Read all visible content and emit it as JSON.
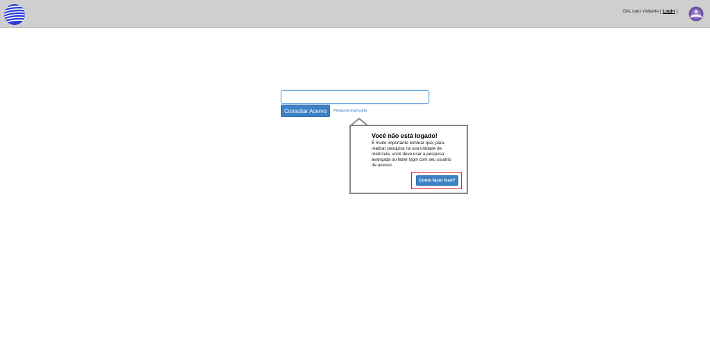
{
  "header": {
    "logo_icon": "globe-logo-icon",
    "greeting_prefix": "Olá, caro visitante [",
    "login_label": "Login",
    "greeting_suffix": "]",
    "avatar_icon": "user-avatar-icon"
  },
  "search": {
    "input_value": "",
    "input_placeholder": "",
    "button_label": "Consultar Acervo",
    "advanced_link": "Pesquisa avançada"
  },
  "popover": {
    "title": "Você não está logado!",
    "body": "É muito importante lembrar que, para realizar pesquisa na sua unidade de matrícula, você deve usar a pesquisa avançada ou fazer login com seu usuário de acesso.",
    "button_label": "Como fazer isso?"
  },
  "colors": {
    "topbar": "#cfcfcf",
    "primary_button": "#3d82c4",
    "highlight_border": "#e01e1e",
    "logo_blue": "#2b3fd6",
    "avatar_purple": "#6a4fa0"
  }
}
